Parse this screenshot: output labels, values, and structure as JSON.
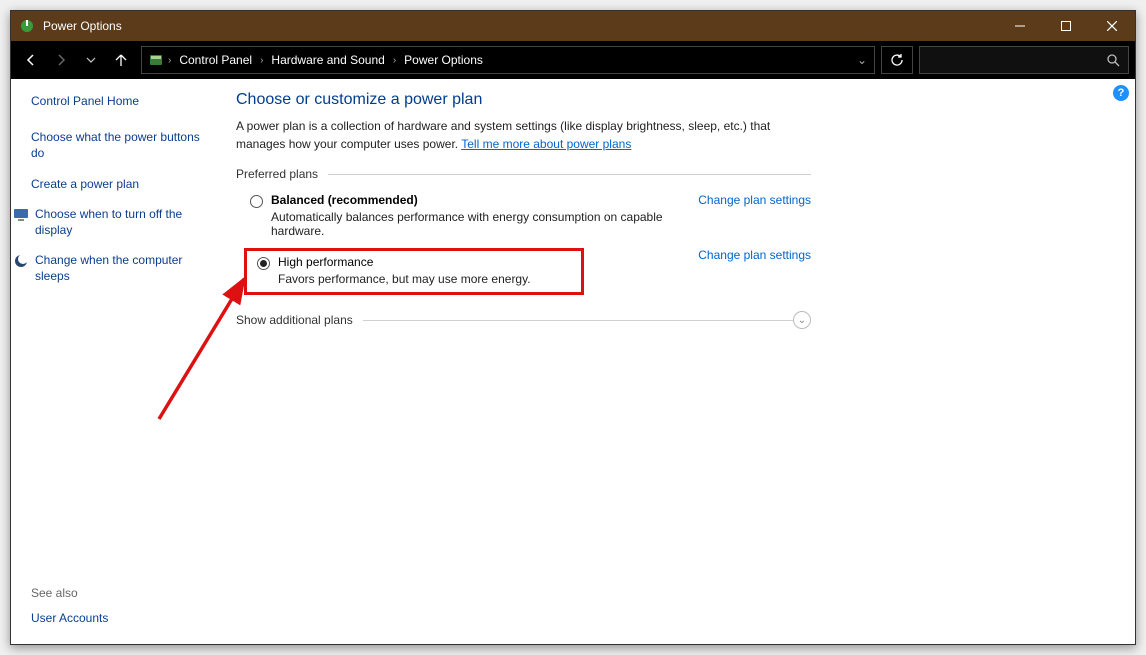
{
  "window": {
    "title": "Power Options"
  },
  "breadcrumb": {
    "items": [
      "Control Panel",
      "Hardware and Sound",
      "Power Options"
    ]
  },
  "sidebar": {
    "home": "Control Panel Home",
    "links": [
      "Choose what the power buttons do",
      "Create a power plan",
      "Choose when to turn off the display",
      "Change when the computer sleeps"
    ],
    "see_also_label": "See also",
    "see_also_links": [
      "User Accounts"
    ]
  },
  "main": {
    "heading": "Choose or customize a power plan",
    "description": "A power plan is a collection of hardware and system settings (like display brightness, sleep, etc.) that manages how your computer uses power. ",
    "learn_link": "Tell me more about power plans",
    "preferred_label": "Preferred plans",
    "plans": [
      {
        "name": "Balanced (recommended)",
        "desc": "Automatically balances performance with energy consumption on capable hardware.",
        "selected": false,
        "change_link": "Change plan settings"
      },
      {
        "name": "High performance",
        "desc": "Favors performance, but may use more energy.",
        "selected": true,
        "change_link": "Change plan settings"
      }
    ],
    "show_more_label": "Show additional plans"
  }
}
